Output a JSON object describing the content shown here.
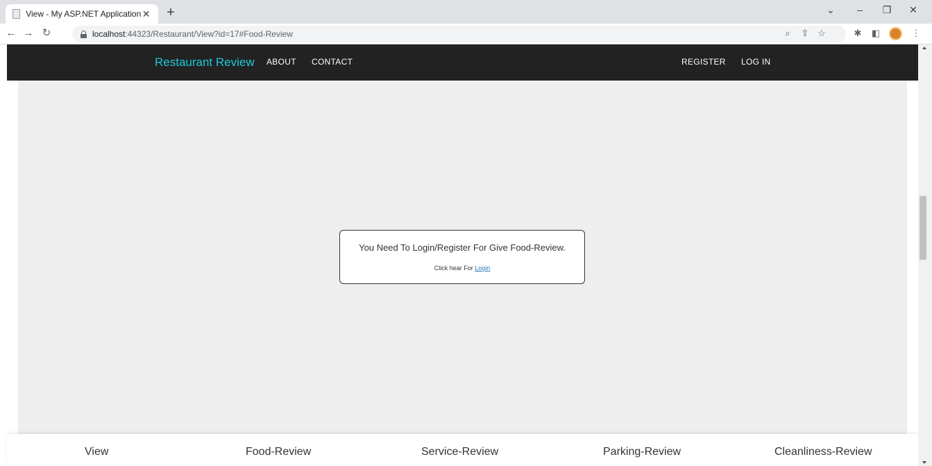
{
  "browser": {
    "tab_title": "View - My ASP.NET Application",
    "tab_close": "✕",
    "new_tab": "+",
    "url_host": "localhost",
    "url_rest": ":44323/Restaurant/View?id=17#Food-Review",
    "icons": [
      "back-icon",
      "forward-icon",
      "reload-icon",
      "lock-icon",
      "zoom-icon",
      "share-icon",
      "star-icon",
      "extensions-icon",
      "sidepanel-icon",
      "menu-icon"
    ]
  },
  "navbar": {
    "brand": "Restaurant Review",
    "links": [
      "ABOUT",
      "CONTACT"
    ],
    "right_links": [
      "REGISTER",
      "LOG IN"
    ],
    "background": "#222222",
    "brand_color": "#1fc8db"
  },
  "notice": {
    "message": "You Need To Login/Register For Give Food-Review.",
    "prefix": "Click hear For",
    "link": "Login"
  },
  "bottom_tabs": [
    "View",
    "Food-Review",
    "Service-Review",
    "Parking-Review",
    "Cleanliness-Review"
  ]
}
